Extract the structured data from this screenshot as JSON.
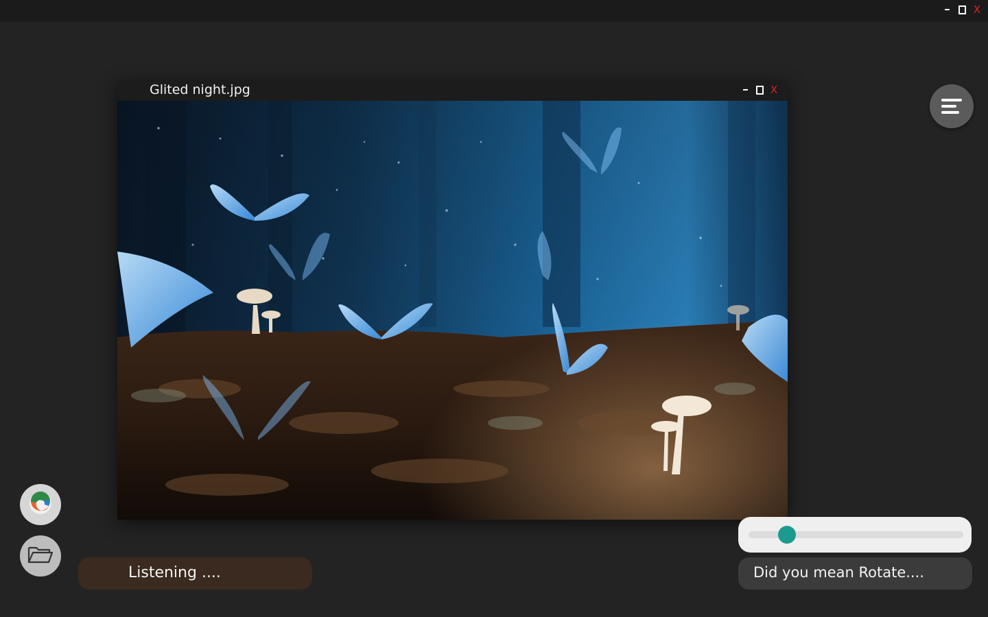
{
  "app": {
    "window_controls": {
      "minimize": "minimize",
      "maximize": "maximize",
      "close_label": "X"
    }
  },
  "image_window": {
    "title": "Glited night.jpg",
    "close_label": "X"
  },
  "assistant": {
    "status_text": "Listening ....",
    "suggestion_text": "Did you mean Rotate....",
    "slider_value": 0.18
  },
  "icons": {
    "menu": "menu-lines-icon",
    "edge": "browser-logo-icon",
    "folder": "folder-open-icon"
  },
  "colors": {
    "accent": "#1c9a8f",
    "close": "#d42525",
    "listening_bg": "#3a2a20"
  }
}
